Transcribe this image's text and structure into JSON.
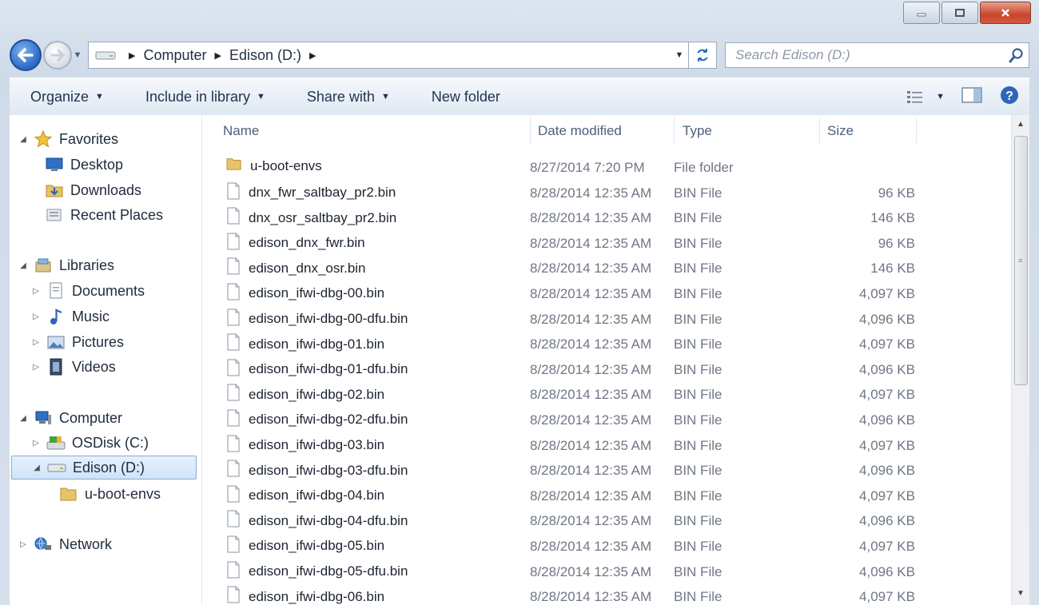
{
  "window": {
    "accent": "#2a68c6"
  },
  "address": {
    "crumbs": [
      "Computer",
      "Edison (D:)"
    ]
  },
  "search": {
    "placeholder": "Search Edison (D:)"
  },
  "commandbar": {
    "organize": "Organize",
    "include_in_library": "Include in library",
    "share_with": "Share with",
    "new_folder": "New folder"
  },
  "navpane": {
    "favorites": "Favorites",
    "desktop": "Desktop",
    "downloads": "Downloads",
    "recent_places": "Recent Places",
    "libraries": "Libraries",
    "documents": "Documents",
    "music": "Music",
    "pictures": "Pictures",
    "videos": "Videos",
    "computer": "Computer",
    "osdisk": "OSDisk (C:)",
    "edison": "Edison (D:)",
    "uboot": "u-boot-envs",
    "network": "Network"
  },
  "columns": {
    "name": "Name",
    "date": "Date modified",
    "type": "Type",
    "size": "Size"
  },
  "files": [
    {
      "name": "u-boot-envs",
      "date": "8/27/2014 7:20 PM",
      "type": "File folder",
      "size": "",
      "icon": "folder-icon"
    },
    {
      "name": "dnx_fwr_saltbay_pr2.bin",
      "date": "8/28/2014 12:35 AM",
      "type": "BIN File",
      "size": "96 KB",
      "icon": "file-icon"
    },
    {
      "name": "dnx_osr_saltbay_pr2.bin",
      "date": "8/28/2014 12:35 AM",
      "type": "BIN File",
      "size": "146 KB",
      "icon": "file-icon"
    },
    {
      "name": "edison_dnx_fwr.bin",
      "date": "8/28/2014 12:35 AM",
      "type": "BIN File",
      "size": "96 KB",
      "icon": "file-icon"
    },
    {
      "name": "edison_dnx_osr.bin",
      "date": "8/28/2014 12:35 AM",
      "type": "BIN File",
      "size": "146 KB",
      "icon": "file-icon"
    },
    {
      "name": "edison_ifwi-dbg-00.bin",
      "date": "8/28/2014 12:35 AM",
      "type": "BIN File",
      "size": "4,097 KB",
      "icon": "file-icon"
    },
    {
      "name": "edison_ifwi-dbg-00-dfu.bin",
      "date": "8/28/2014 12:35 AM",
      "type": "BIN File",
      "size": "4,096 KB",
      "icon": "file-icon"
    },
    {
      "name": "edison_ifwi-dbg-01.bin",
      "date": "8/28/2014 12:35 AM",
      "type": "BIN File",
      "size": "4,097 KB",
      "icon": "file-icon"
    },
    {
      "name": "edison_ifwi-dbg-01-dfu.bin",
      "date": "8/28/2014 12:35 AM",
      "type": "BIN File",
      "size": "4,096 KB",
      "icon": "file-icon"
    },
    {
      "name": "edison_ifwi-dbg-02.bin",
      "date": "8/28/2014 12:35 AM",
      "type": "BIN File",
      "size": "4,097 KB",
      "icon": "file-icon"
    },
    {
      "name": "edison_ifwi-dbg-02-dfu.bin",
      "date": "8/28/2014 12:35 AM",
      "type": "BIN File",
      "size": "4,096 KB",
      "icon": "file-icon"
    },
    {
      "name": "edison_ifwi-dbg-03.bin",
      "date": "8/28/2014 12:35 AM",
      "type": "BIN File",
      "size": "4,097 KB",
      "icon": "file-icon"
    },
    {
      "name": "edison_ifwi-dbg-03-dfu.bin",
      "date": "8/28/2014 12:35 AM",
      "type": "BIN File",
      "size": "4,096 KB",
      "icon": "file-icon"
    },
    {
      "name": "edison_ifwi-dbg-04.bin",
      "date": "8/28/2014 12:35 AM",
      "type": "BIN File",
      "size": "4,097 KB",
      "icon": "file-icon"
    },
    {
      "name": "edison_ifwi-dbg-04-dfu.bin",
      "date": "8/28/2014 12:35 AM",
      "type": "BIN File",
      "size": "4,096 KB",
      "icon": "file-icon"
    },
    {
      "name": "edison_ifwi-dbg-05.bin",
      "date": "8/28/2014 12:35 AM",
      "type": "BIN File",
      "size": "4,097 KB",
      "icon": "file-icon"
    },
    {
      "name": "edison_ifwi-dbg-05-dfu.bin",
      "date": "8/28/2014 12:35 AM",
      "type": "BIN File",
      "size": "4,096 KB",
      "icon": "file-icon"
    },
    {
      "name": "edison_ifwi-dbg-06.bin",
      "date": "8/28/2014 12:35 AM",
      "type": "BIN File",
      "size": "4,097 KB",
      "icon": "file-icon"
    }
  ]
}
